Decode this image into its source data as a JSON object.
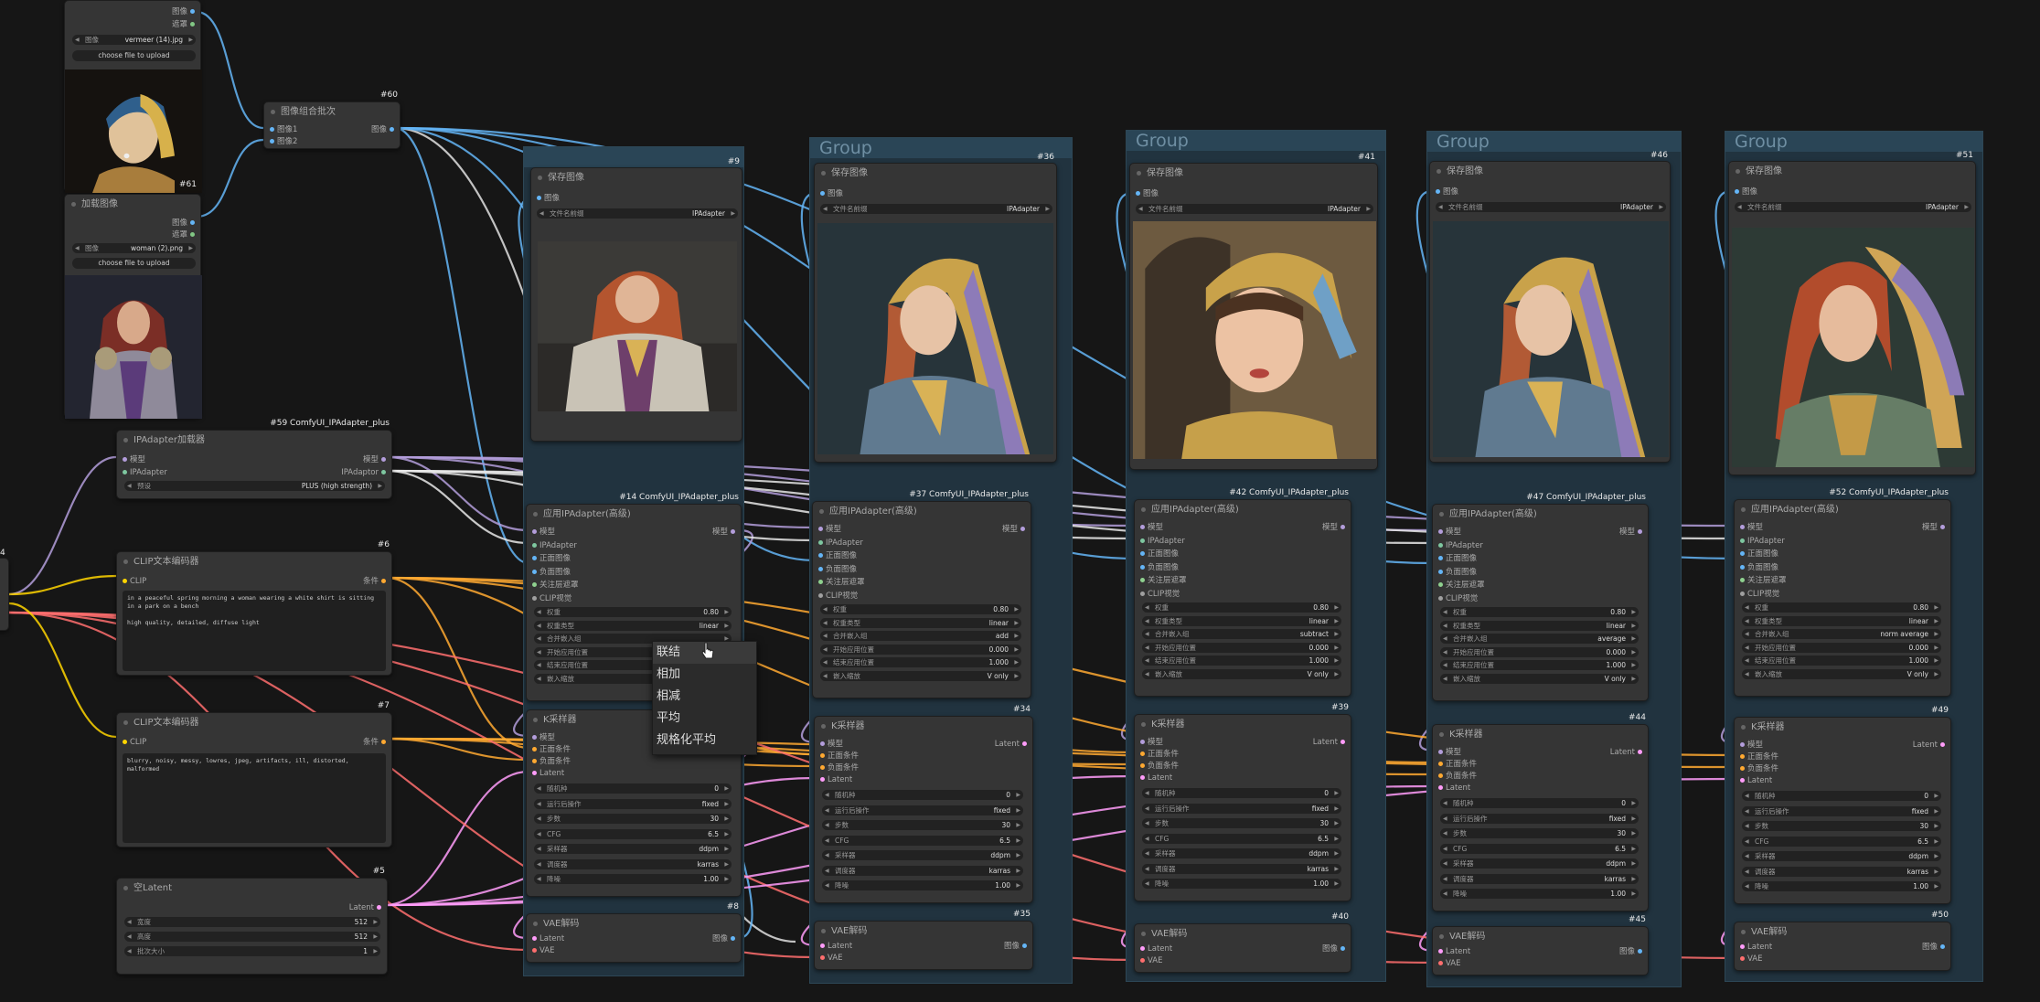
{
  "colors": {
    "model": "#b39ddb",
    "clip": "#ffd500",
    "cond": "#ffa931",
    "latent": "#ff9cf9",
    "image": "#64b5f6",
    "vae": "#ff6e6e",
    "ipadapter": "#7ec7a0",
    "group": "#21333f"
  },
  "load_image_1": {
    "out_image": "图像",
    "out_mask": "遮罩",
    "field_label": "图像",
    "filename": "vermeer (14).jpg",
    "upload": "choose file to upload",
    "id": "#61"
  },
  "load_image_2": {
    "title": "加载图像",
    "out_image": "图像",
    "out_mask": "遮罩",
    "field_label": "图像",
    "filename": "woman (2).png",
    "upload": "choose file to upload"
  },
  "batch_node": {
    "title": "图像组合批次",
    "in1": "图像1",
    "in2": "图像2",
    "out": "图像",
    "id": "#60"
  },
  "ipa_loader": {
    "title": "IPAdapter加载器",
    "id": "#59 ComfyUI_IPAdapter_plus",
    "in_model": "模型",
    "in_ipa": "IPAdapter",
    "out_model": "模型",
    "out_ipa": "IPAdaptor",
    "preset_label": "预设",
    "preset": "PLUS (high strength)"
  },
  "clip_pos": {
    "title": "CLIP文本编码器",
    "id": "#6",
    "in": "CLIP",
    "out": "条件",
    "text": "in a peaceful spring morning a woman wearing a white shirt is sitting in a park on a bench\n\nhigh quality, detailed, diffuse light"
  },
  "clip_neg": {
    "title": "CLIP文本编码器",
    "id": "#7",
    "in": "CLIP",
    "out": "条件",
    "text": "blurry, noisy, messy, lowres, jpeg, artifacts, ill, distorted, malformed"
  },
  "empty_latent": {
    "title": "空Latent",
    "id": "#5",
    "out": "Latent",
    "w_label": "宽度",
    "w": "512",
    "h_label": "高度",
    "h": "512",
    "b_label": "批次大小",
    "b": "1"
  },
  "left_id": "4",
  "groups": [
    {
      "title": "",
      "save_id": "#9",
      "ipa_id": "#14 ComfyUI_IPAdapter_plus",
      "ks_id": "",
      "vae_id": "#8",
      "weight_type": "linear",
      "combine": "",
      "end": "",
      "embeds": "",
      "ipa_title": "应用IPAdapter(高级)"
    },
    {
      "title": "Group",
      "save_id": "#36",
      "ipa_id": "#37 ComfyUI_IPAdapter_plus",
      "ks_id": "#34",
      "vae_id": "#35",
      "weight_type": "linear",
      "combine": "add",
      "end": "1.000",
      "embeds": "V only",
      "ipa_title": "应用IPAdapter(高级)"
    },
    {
      "title": "Group",
      "save_id": "#41",
      "ipa_id": "#42 ComfyUI_IPAdapter_plus",
      "ks_id": "#39",
      "vae_id": "#40",
      "weight_type": "linear",
      "combine": "subtract",
      "end": "1.000",
      "embeds": "V only",
      "ipa_title": "应用IPAdapter(高级)"
    },
    {
      "title": "Group",
      "save_id": "#46",
      "ipa_id": "#47 ComfyUI_IPAdapter_plus",
      "ks_id": "#44",
      "vae_id": "#45",
      "weight_type": "linear",
      "combine": "average",
      "end": "1.000",
      "embeds": "V only",
      "ipa_title": "应用IPAdapter(高级)"
    },
    {
      "title": "Group",
      "save_id": "#51",
      "ipa_id": "#52 ComfyUI_IPAdapter_plus",
      "ks_id": "#49",
      "vae_id": "#50",
      "weight_type": "linear",
      "combine": "norm average",
      "end": "1.000",
      "embeds": "V only",
      "ipa_title": "应用IPAdapter(高级)"
    }
  ],
  "save": {
    "title": "保存图像",
    "in": "图像",
    "prefix_label": "文件名前缀",
    "prefix": "IPAdapter"
  },
  "ipa": {
    "in_model": "模型",
    "in_ipa": "IPAdapter",
    "in_pos": "正面图像",
    "in_neg": "负面图像",
    "in_attn": "关注层遮罩",
    "in_clipv": "CLIP视觉",
    "out_model": "模型",
    "weight_label": "权重",
    "weight": "0.80",
    "weight_type_label": "权重类型",
    "combine_label": "合并嵌入组",
    "start_label": "开始应用位置",
    "start": "0.000",
    "end_label": "结束应用位置",
    "embeds_label": "嵌入缩放",
    "first_weight": "0.80"
  },
  "ksampler": {
    "title": "K采样器",
    "in_model": "模型",
    "in_pos": "正面条件",
    "in_neg": "负面条件",
    "in_latent": "Latent",
    "out": "Latent",
    "seed_label": "随机种",
    "seed": "0",
    "ctrl_label": "运行后操作",
    "ctrl": "fixed",
    "steps_label": "步数",
    "steps": "30",
    "cfg_label": "CFG",
    "cfg": "6.5",
    "sampler_label": "采样器",
    "sampler": "ddpm",
    "sched_label": "调度器",
    "sched": "karras",
    "denoise_label": "降噪",
    "denoise": "1.00"
  },
  "vae": {
    "title": "VAE解码",
    "in_latent": "Latent",
    "in_vae": "VAE",
    "out": "图像"
  },
  "context_menu": [
    "联结",
    "相加",
    "相减",
    "平均",
    "规格化平均"
  ]
}
